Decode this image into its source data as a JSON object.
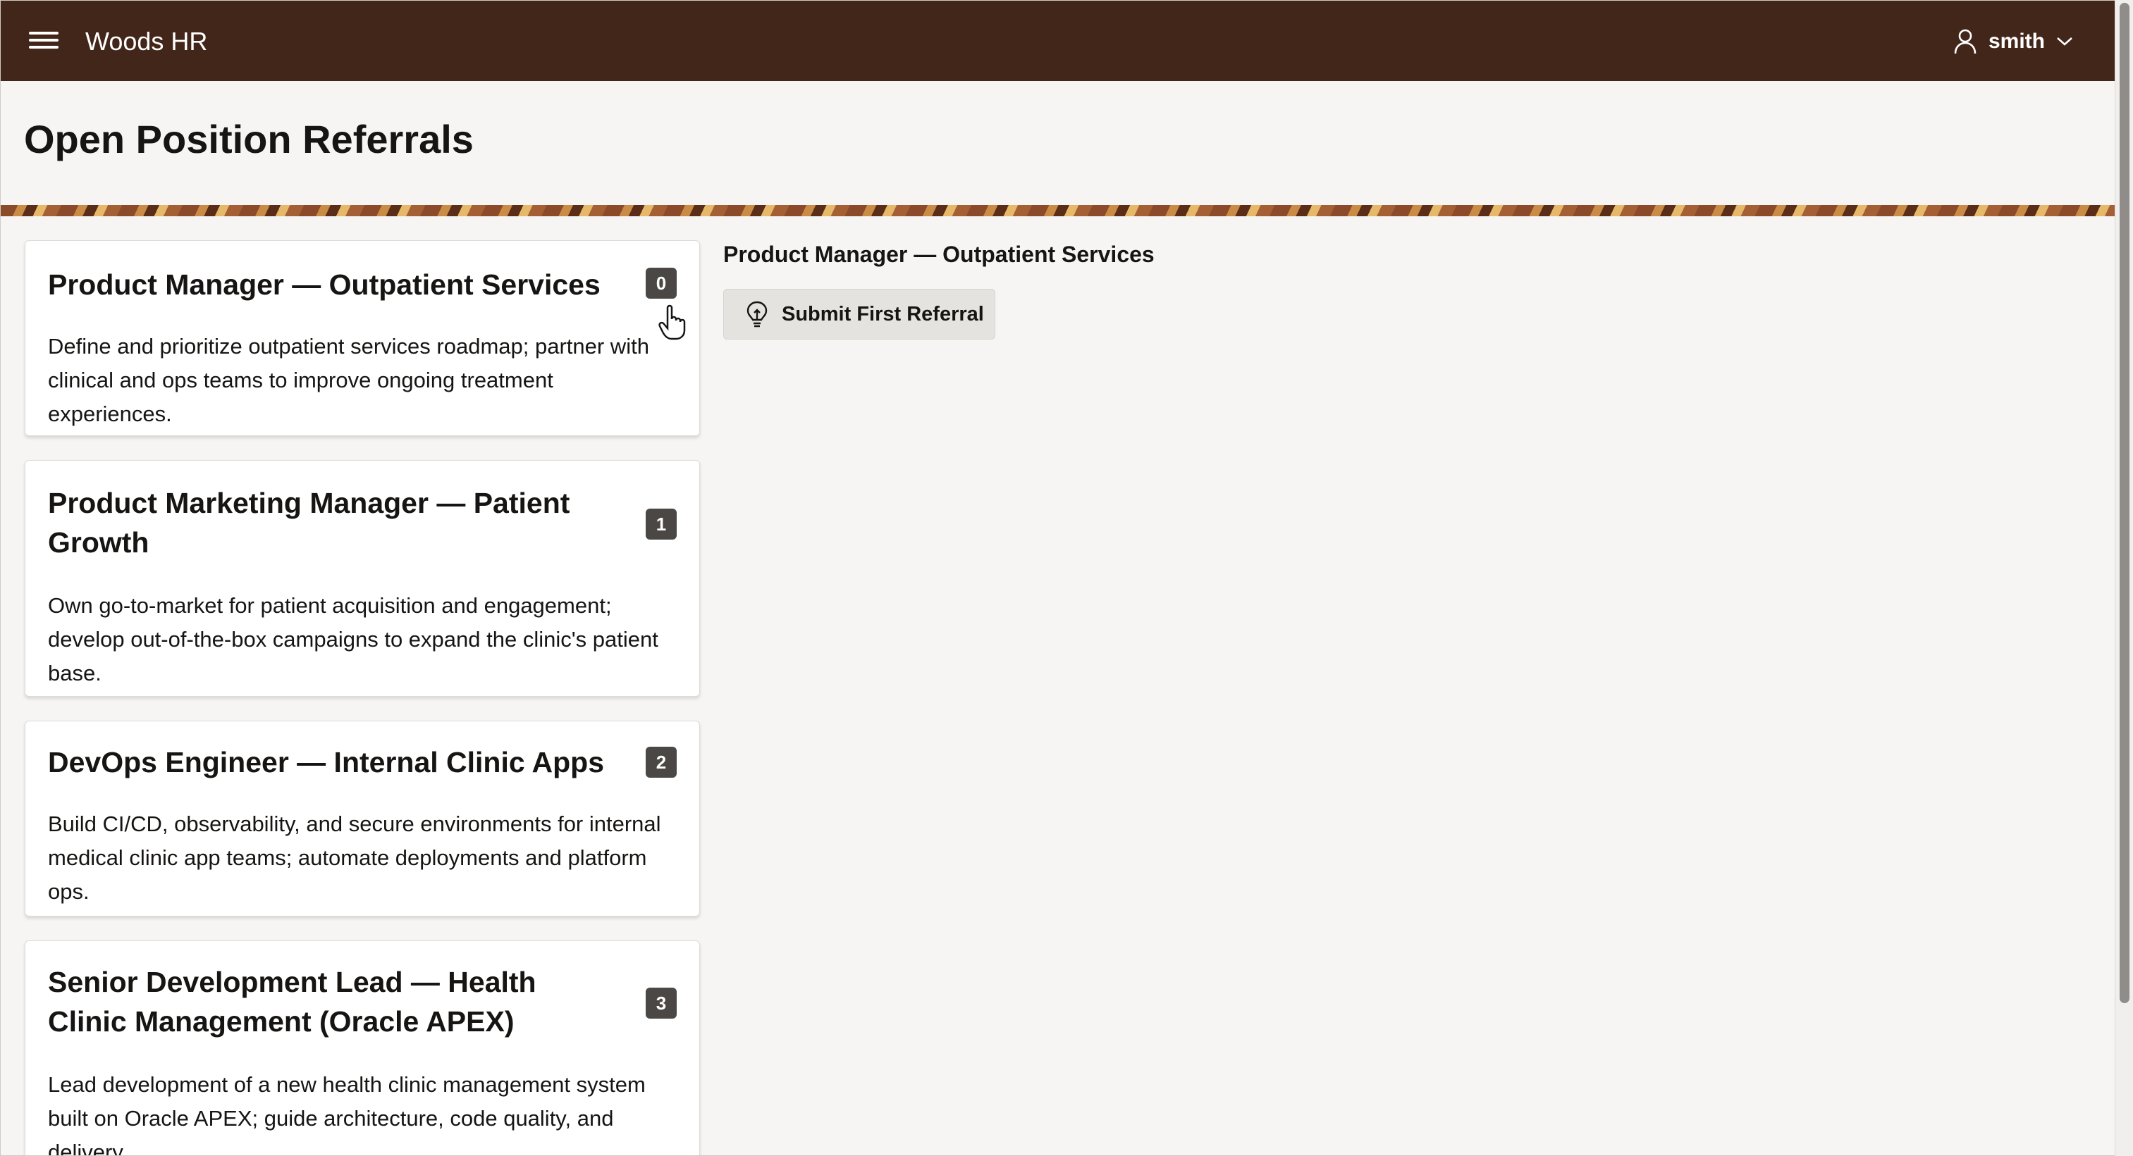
{
  "app": {
    "title": "Woods HR",
    "user": "smith"
  },
  "page": {
    "title": "Open Position Referrals"
  },
  "positions": [
    {
      "title": "Product Manager — Outpatient Services",
      "count": "0",
      "description": "Define and prioritize outpatient services roadmap; partner with clinical and ops teams to improve ongoing treatment experiences."
    },
    {
      "title": "Product Marketing Manager — Patient Growth",
      "count": "1",
      "description": "Own go-to-market for patient acquisition and engagement; develop out-of-the-box campaigns to expand the clinic's patient base."
    },
    {
      "title": "DevOps Engineer — Internal Clinic Apps",
      "count": "2",
      "description": "Build CI/CD, observability, and secure environments for internal medical clinic app teams; automate deployments and platform ops."
    },
    {
      "title": "Senior Development Lead — Health Clinic Management (Oracle APEX)",
      "count": "3",
      "description": "Lead development of a new health clinic management system built on Oracle APEX; guide architecture, code quality, and delivery."
    }
  ],
  "detail": {
    "title": "Product Manager — Outpatient Services",
    "button_label": "Submit First Referral",
    "button_icon": "lightbulb-icon"
  },
  "icons": {
    "menu": "hamburger-icon",
    "user": "user-icon",
    "dropdown": "chevron-down-icon"
  },
  "colors": {
    "header": "#43261a",
    "badge": "#4a4744",
    "background": "#f6f5f3"
  }
}
